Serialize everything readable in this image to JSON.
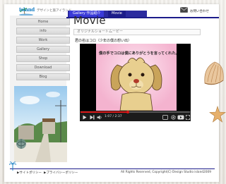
{
  "header": {
    "logo": "island",
    "tagline": "デザインと旅アイランド",
    "tabs": [
      {
        "label": "Gallery 作品紹介"
      },
      {
        "label": "Movie"
      }
    ],
    "contact": "お問い合わせ"
  },
  "sidebar": {
    "items": [
      {
        "label": "Home"
      },
      {
        "label": "info"
      },
      {
        "label": "Work"
      },
      {
        "label": "Gallery"
      },
      {
        "label": "Shop"
      },
      {
        "label": "Download"
      },
      {
        "label": "Blog"
      }
    ]
  },
  "main": {
    "title": "Movie",
    "subtitle": "オリジナルショートムービー",
    "video_caption": "君の名はコロ（少年の僕の想い出）",
    "video_subtitle": "僕の手でコロは僕にありがとうを言ってくれた。"
  },
  "player": {
    "time": "1:07 / 2:37",
    "progress": 0.43
  },
  "footer": {
    "link1": "▶サイトポリシー",
    "link2": "▶プライバシーポリシー",
    "copyright": "All Rights Reserved, Copyright(C) Design Studio island2009"
  },
  "colors": {
    "accent": "#1c1c8a",
    "progress": "#d91818"
  }
}
